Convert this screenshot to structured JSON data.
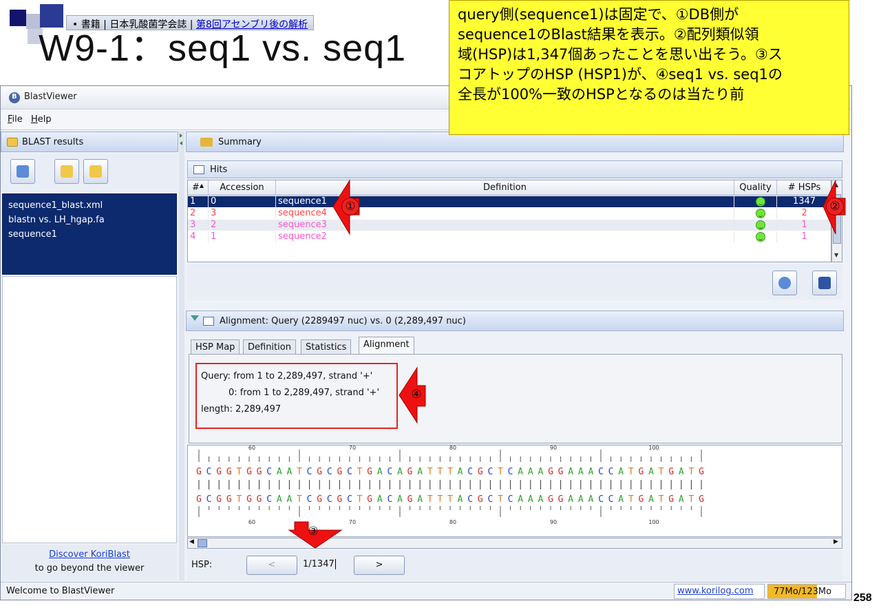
{
  "slide": {
    "breadcrumb_prefix": "• 書籍 | 日本乳酸菌学会誌 | ",
    "breadcrumb_link": "第8回アセンブリ後の解析",
    "title": "W9-1：seq1 vs. seq1",
    "page_number": "258"
  },
  "callout": {
    "lines": [
      "query側(sequence1)は固定で、①DB側が",
      "sequence1のBlast結果を表示。②配列類似領",
      "域(HSP)は1,347個あったことを思い出そう。③ス",
      "コアトップのHSP (HSP1)が、④seq1 vs. seq1の",
      "全長が100%一致のHSPとなるのは当たり前"
    ]
  },
  "markers": {
    "m1": "①",
    "m2": "②",
    "m3": "③",
    "m4": "④"
  },
  "window": {
    "title": "BlastViewer"
  },
  "menu": {
    "file": "File",
    "help": "Help"
  },
  "left": {
    "header": "BLAST results",
    "files": [
      "sequence1_blast.xml",
      "blastn vs. LH_hgap.fa",
      "sequence1"
    ],
    "discover_link": "Discover KoriBlast",
    "discover_text": "to go beyond the viewer"
  },
  "summary": {
    "header": "Summary"
  },
  "hits": {
    "header": "Hits",
    "columns": [
      "#",
      "Accession",
      "Definition",
      "Quality",
      "# HSPs"
    ],
    "rows": [
      {
        "num": "1",
        "acc": "0",
        "def": "sequence1",
        "hsps": "1347"
      },
      {
        "num": "2",
        "acc": "3",
        "def": "sequence4",
        "hsps": "2"
      },
      {
        "num": "3",
        "acc": "2",
        "def": "sequence3",
        "hsps": "1"
      },
      {
        "num": "4",
        "acc": "1",
        "def": "sequence2",
        "hsps": "1"
      }
    ]
  },
  "alignment": {
    "header": "Alignment: Query (2289497 nuc) vs. 0 (2,289,497 nuc)",
    "tabs": [
      "HSP Map",
      "Definition",
      "Statistics",
      "Alignment"
    ],
    "active_tab": "Alignment",
    "info": [
      "Query: from 1 to 2,289,497, strand '+'",
      "0: from 1 to 2,289,497, strand '+'",
      "length: 2,289,497"
    ],
    "sequence": "GCGGTGGCAATCGCGCTGACAGATTTACGCTCAAAGGAAACCATGATGATG",
    "tick_labels": [
      "60",
      "70",
      "80",
      "90",
      "100"
    ]
  },
  "hsp": {
    "label": "HSP:",
    "prev": "<",
    "next": ">",
    "value": "1/1347"
  },
  "status": {
    "message": "Welcome to BlastViewer",
    "url": "www.korilog.com",
    "memory": "77Mo/123Mo",
    "memory_used_fraction": 0.63
  },
  "colors": {
    "A": "#2ca02c",
    "C": "#1f3fd6",
    "G": "#d62728",
    "T": "#e07b1a"
  }
}
